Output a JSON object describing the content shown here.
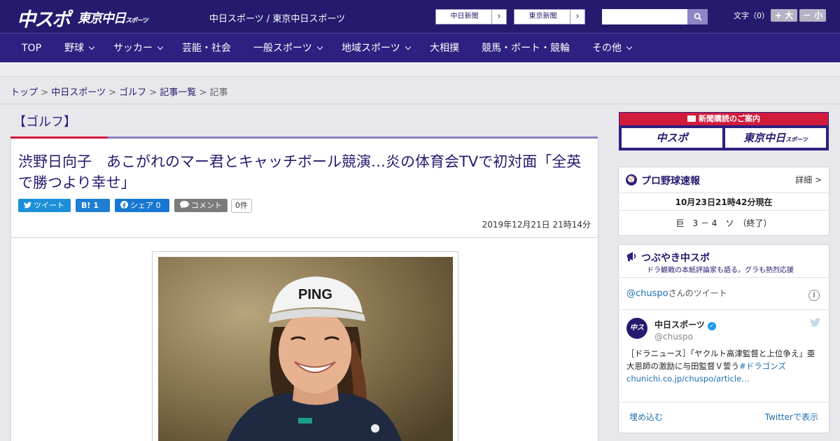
{
  "header": {
    "logo_chuspo": "中スポ",
    "logo_tokyo": "東京中日",
    "logo_tokyo_small": "スポーツ",
    "site_names": "中日スポーツ / 東京中日スポーツ",
    "link_chunichi": "中日新聞",
    "link_tokyo": "東京新聞",
    "link_arrow": "›",
    "search_placeholder": "",
    "font_size_label": "文字（0）",
    "font_plus": "+ 大",
    "font_minus": "－ 小"
  },
  "nav": {
    "items": [
      {
        "label": "TOP"
      },
      {
        "label": "野球"
      },
      {
        "label": "サッカー"
      },
      {
        "label": "芸能・社会"
      },
      {
        "label": "一般スポーツ"
      },
      {
        "label": "地域スポーツ"
      },
      {
        "label": "大相撲"
      },
      {
        "label": "競馬・ボート・競輪"
      },
      {
        "label": "その他"
      }
    ]
  },
  "breadcrumb": {
    "items": [
      "トップ",
      "中日スポーツ",
      "ゴルフ",
      "記事一覧"
    ],
    "current": "記事",
    "sep": ">"
  },
  "article": {
    "category": "【ゴルフ】",
    "headline": "渋野日向子　あこがれのマー君とキャッチボール競演…炎の体育会TVで初対面「全英で勝つより幸せ」",
    "share_tweet": "ツイート",
    "share_hatena": "B! 1",
    "share_facebook": "シェア 0",
    "share_comment": "コメント",
    "comment_count": "0件",
    "date": "2019年12月21日 21時14分",
    "photo_cap_text": "PING"
  },
  "sidebar": {
    "banner_title": "新聞購読のご案内",
    "banner_chuspo": "中スポ",
    "banner_tokyo": "東京中日",
    "banner_tokyo_small": "スポーツ",
    "baseball_title": "プロ野球速報",
    "baseball_detail": "詳細 >",
    "baseball_time": "10月23日21時42分現在",
    "baseball_score": "巨　3 － 4　ソ　（終了）",
    "tsubuyaki_title": "つぶやき中スポ",
    "tsubuyaki_sub": "ドラ観戦の本紙評論家も語る。グラも熱烈応援",
    "tw_handle_link": "@chuspo",
    "tw_handle_suffix": "さんの",
    "tw_header_big": "ツイート",
    "tw_name": "中日スポーツ",
    "tw_handle": "@chuspo",
    "tw_text_1": "［ドラニュース］「ヤクルト高津監督と上位争え」亜大恩師の激励に与田監督Ｖ誓う",
    "tw_text_tag": "#ドラゴンズ",
    "tw_text_link": "chunichi.co.jp/chuspo/article…",
    "tw_embed": "埋め込む",
    "tw_view": "Twitterで表示"
  },
  "colors": {
    "brand_navy": "#241a6e",
    "nav_purple": "#2d2080",
    "accent_red": "#d21c3c",
    "twitter_blue": "#1d8fd8"
  }
}
